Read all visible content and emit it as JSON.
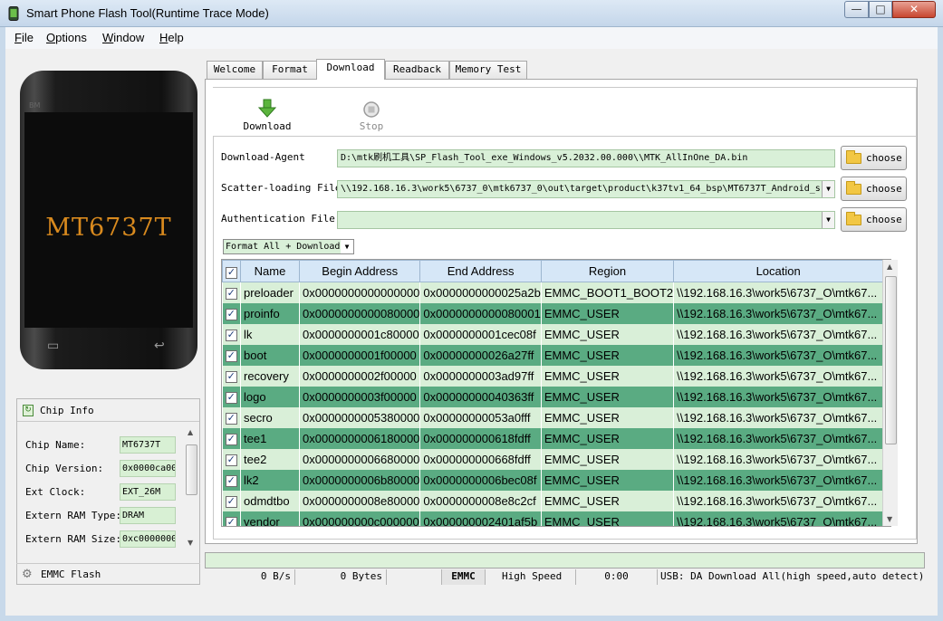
{
  "window": {
    "title": "Smart Phone Flash Tool(Runtime Trace Mode)",
    "min": "—",
    "max": "□",
    "close": "✕"
  },
  "menu": {
    "file": "ile",
    "file_key": "F",
    "options": "ptions",
    "options_key": "O",
    "window": "indow",
    "window_key": "W",
    "help": "elp",
    "help_key": "H"
  },
  "phone": {
    "brand": "BM",
    "model": "MT6737T",
    "menu_key": "▭",
    "back_key": "↩"
  },
  "chip_info": {
    "title": "Chip Info",
    "rows": [
      {
        "label": "Chip Name:",
        "value": "MT6737T"
      },
      {
        "label": "Chip Version:",
        "value": "0x0000ca00"
      },
      {
        "label": "Ext Clock:",
        "value": "EXT_26M"
      },
      {
        "label": "Extern RAM Type:",
        "value": "DRAM"
      },
      {
        "label": "Extern RAM Size:",
        "value": "0xc0000000"
      }
    ],
    "emmc_label": "EMMC Flash"
  },
  "tabs": [
    "Welcome",
    "Format",
    "Download",
    "Readback",
    "Memory Test"
  ],
  "toolbar": {
    "download": "Download",
    "stop": "Stop"
  },
  "form": {
    "download_agent_label": "Download-Agent",
    "download_agent_value": "D:\\mtk刷机工具\\SP_Flash_Tool_exe_Windows_v5.2032.00.000\\\\MTK_AllInOne_DA.bin",
    "scatter_label": "Scatter-loading File",
    "scatter_value": "\\\\192.168.16.3\\work5\\6737_0\\mtk6737_0\\out\\target\\product\\k37tv1_64_bsp\\MT6737T_Android_s",
    "auth_label": "Authentication File",
    "auth_value": "",
    "choose": "choose",
    "mode": "Format All + Download"
  },
  "table": {
    "headers": [
      "Name",
      "Begin Address",
      "End Address",
      "Region",
      "Location"
    ],
    "rows": [
      [
        "preloader",
        "0x0000000000000000",
        "0x0000000000025a2b",
        "EMMC_BOOT1_BOOT2",
        "\\\\192.168.16.3\\work5\\6737_O\\mtk67..."
      ],
      [
        "proinfo",
        "0x0000000000080000",
        "0x0000000000080001",
        "EMMC_USER",
        "\\\\192.168.16.3\\work5\\6737_O\\mtk67..."
      ],
      [
        "lk",
        "0x0000000001c80000",
        "0x0000000001cec08f",
        "EMMC_USER",
        "\\\\192.168.16.3\\work5\\6737_O\\mtk67..."
      ],
      [
        "boot",
        "0x0000000001f00000",
        "0x00000000026a27ff",
        "EMMC_USER",
        "\\\\192.168.16.3\\work5\\6737_O\\mtk67..."
      ],
      [
        "recovery",
        "0x0000000002f00000",
        "0x0000000003ad97ff",
        "EMMC_USER",
        "\\\\192.168.16.3\\work5\\6737_O\\mtk67..."
      ],
      [
        "logo",
        "0x0000000003f00000",
        "0x00000000040363ff",
        "EMMC_USER",
        "\\\\192.168.16.3\\work5\\6737_O\\mtk67..."
      ],
      [
        "secro",
        "0x0000000005380000",
        "0x00000000053a0fff",
        "EMMC_USER",
        "\\\\192.168.16.3\\work5\\6737_O\\mtk67..."
      ],
      [
        "tee1",
        "0x0000000006180000",
        "0x000000000618fdff",
        "EMMC_USER",
        "\\\\192.168.16.3\\work5\\6737_O\\mtk67..."
      ],
      [
        "tee2",
        "0x0000000006680000",
        "0x000000000668fdff",
        "EMMC_USER",
        "\\\\192.168.16.3\\work5\\6737_O\\mtk67..."
      ],
      [
        "lk2",
        "0x0000000006b80000",
        "0x0000000006bec08f",
        "EMMC_USER",
        "\\\\192.168.16.3\\work5\\6737_O\\mtk67..."
      ],
      [
        "odmdtbo",
        "0x0000000008e80000",
        "0x0000000008e8c2cf",
        "EMMC_USER",
        "\\\\192.168.16.3\\work5\\6737_O\\mtk67..."
      ],
      [
        "vendor",
        "0x000000000c000000",
        "0x000000002401af5b",
        "EMMC_USER",
        "\\\\192.168.16.3\\work5\\6737_O\\mtk67..."
      ]
    ]
  },
  "status": {
    "speed": "0 B/s",
    "bytes": "0 Bytes",
    "storage": "EMMC",
    "mode": "High Speed",
    "time": "0:00",
    "usb": "USB: DA Download All(high speed,auto detect)"
  },
  "colors": {
    "field_bg": "#d9f0d8",
    "row_light": "#d9efd8",
    "row_dark": "#5aab82",
    "header_bg": "#d6e7f7",
    "phone_text": "#d98a1e"
  },
  "progress": {
    "fraction": 0
  }
}
